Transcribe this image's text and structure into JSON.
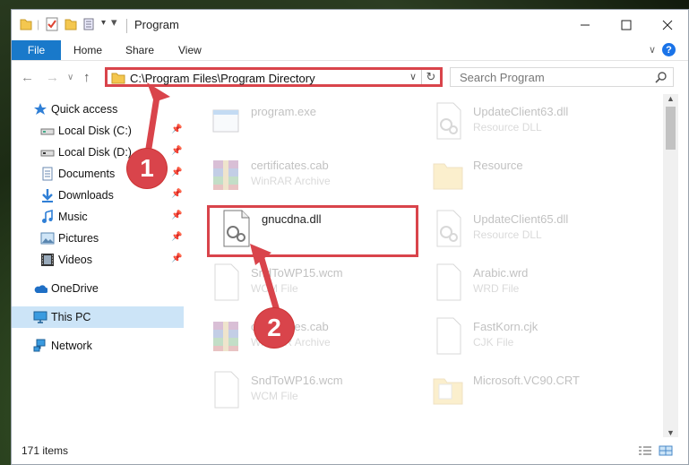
{
  "window": {
    "title": "Program"
  },
  "ribbon": {
    "file": "File",
    "tabs": [
      "Home",
      "Share",
      "View"
    ],
    "help": "?"
  },
  "address": {
    "path": "C:\\Program Files\\Program Directory"
  },
  "search": {
    "placeholder": "Search Program"
  },
  "sidebar": {
    "items": [
      {
        "label": "Quick access",
        "icon": "star-icon",
        "pinned": false
      },
      {
        "label": "Local Disk (C:)",
        "icon": "drive-icon",
        "pinned": true
      },
      {
        "label": "Local Disk (D:)",
        "icon": "drive-icon",
        "pinned": true
      },
      {
        "label": "Documents",
        "icon": "documents-icon",
        "pinned": true
      },
      {
        "label": "Downloads",
        "icon": "download-icon",
        "pinned": true
      },
      {
        "label": "Music",
        "icon": "music-icon",
        "pinned": true
      },
      {
        "label": "Pictures",
        "icon": "pictures-icon",
        "pinned": true
      },
      {
        "label": "Videos",
        "icon": "videos-icon",
        "pinned": true
      },
      {
        "label": "OneDrive",
        "icon": "cloud-icon",
        "pinned": false
      },
      {
        "label": "This PC",
        "icon": "computer-icon",
        "pinned": false,
        "selected": true
      },
      {
        "label": "Network",
        "icon": "network-icon",
        "pinned": false
      }
    ]
  },
  "files": [
    {
      "name": "program.exe",
      "type": "",
      "icon": "exe-icon"
    },
    {
      "name": "UpdateClient63.dll",
      "type": "Resource DLL",
      "icon": "dll-icon"
    },
    {
      "name": "certificates.cab",
      "type": "WinRAR Archive",
      "icon": "archive-icon"
    },
    {
      "name": "Resource",
      "type": "",
      "icon": "folder-icon"
    },
    {
      "name": "gnucdna.dll",
      "type": "",
      "icon": "dll-icon"
    },
    {
      "name": "UpdateClient65.dll",
      "type": "Resource DLL",
      "icon": "dll-icon"
    },
    {
      "name": "SndToWP15.wcm",
      "type": "WCM File",
      "icon": "blank-file-icon"
    },
    {
      "name": "Arabic.wrd",
      "type": "WRD File",
      "icon": "blank-file-icon"
    },
    {
      "name": "certificates.cab",
      "type": "WinRAR Archive",
      "icon": "archive-icon"
    },
    {
      "name": "FastKorn.cjk",
      "type": "CJK File",
      "icon": "blank-file-icon"
    },
    {
      "name": "SndToWP16.wcm",
      "type": "WCM File",
      "icon": "blank-file-icon"
    },
    {
      "name": "Microsoft.VC90.CRT",
      "type": "",
      "icon": "folder-icon"
    }
  ],
  "status": {
    "count": "171 items"
  },
  "markers": [
    "1",
    "2"
  ],
  "colors": {
    "accent": "#1979ca",
    "highlight": "#d9444b",
    "selected": "#cce4f7"
  }
}
